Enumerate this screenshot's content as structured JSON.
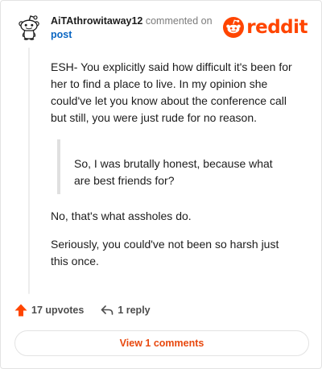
{
  "comment": {
    "username": "AiTAthrowitaway12",
    "action_text": "commented on",
    "post_link": "post",
    "paragraph_1": "ESH- You explicitly said how difficult it's been for her to find a place to live. In my opinion she could've let you know about the conference call but still, you were just rude for no reason.",
    "quote": "So, I was brutally honest, because what are best friends for?",
    "paragraph_2": "No, that's what assholes do.",
    "paragraph_3": "Seriously, you could've not been so harsh just this once."
  },
  "brand": {
    "wordmark": "reddit",
    "color": "#ff4500"
  },
  "actions": {
    "upvotes": "17 upvotes",
    "reply": "1 reply",
    "upvote_icon": "upvote-arrow-icon",
    "reply_icon": "reply-arrow-icon"
  },
  "footer": {
    "view_comments": "View 1 comments",
    "accent_color": "#e8480e"
  }
}
